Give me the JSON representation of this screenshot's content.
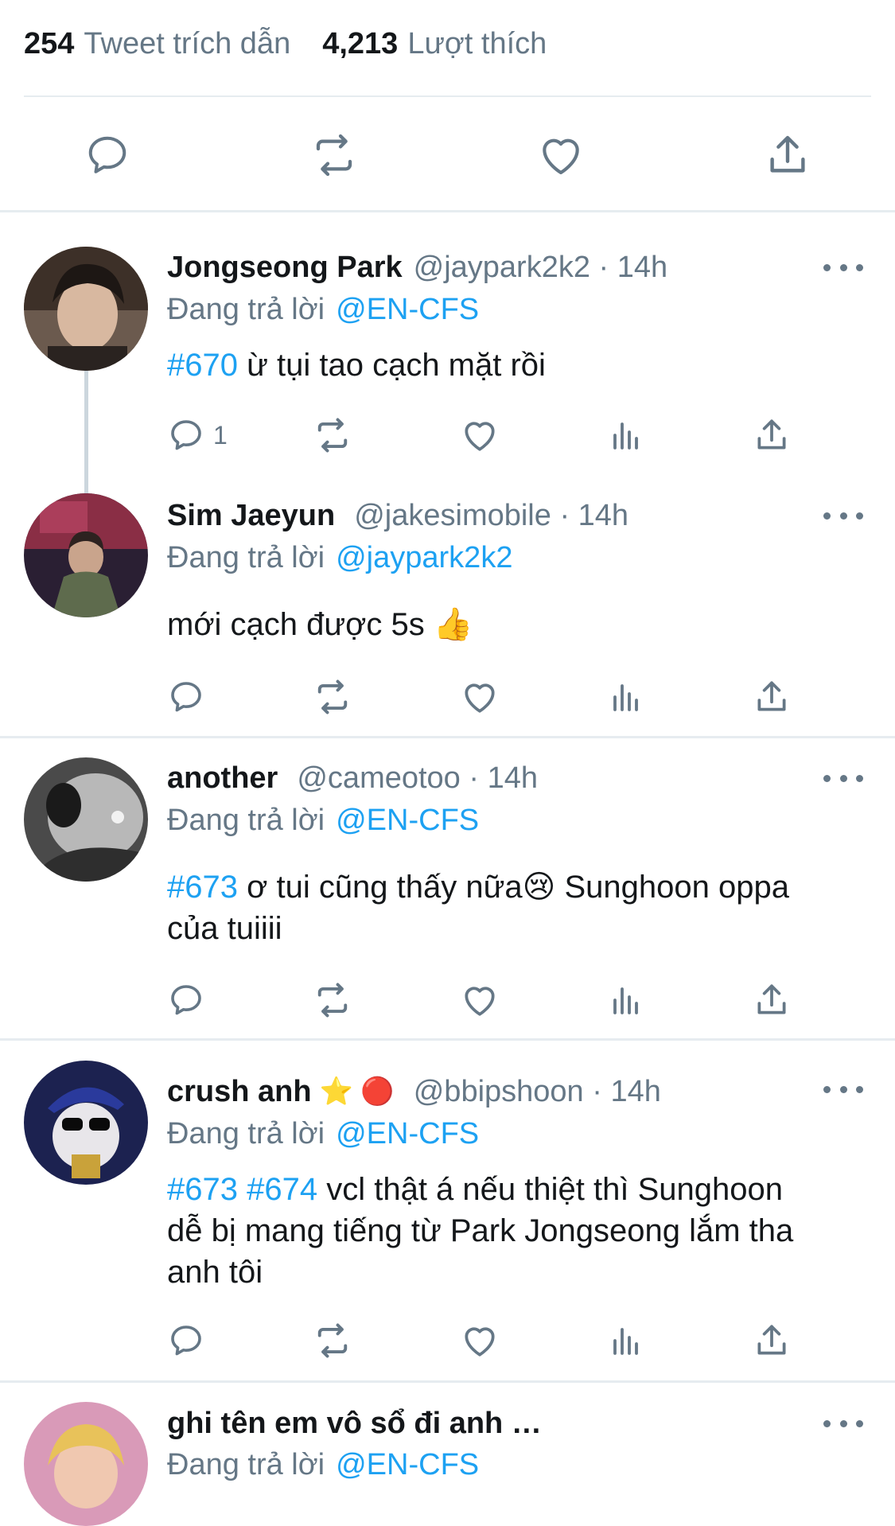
{
  "stats": {
    "quote_count": "254",
    "quote_label": "Tweet trích dẫn",
    "like_count": "4,213",
    "like_label": "Lượt thích"
  },
  "colors": {
    "accent": "#1da1f2",
    "secondary_text": "#657786",
    "divider": "#e6ecf0"
  },
  "reply_prefix": "Đang trả lời",
  "tweets": [
    {
      "name": "Jongseong Park",
      "handle": "@jaypark2k2 · 14h",
      "reply_to": "@EN-CFS",
      "tags": "#670",
      "text": "ừ tụi tao cạch mặt rồi",
      "reply_count": "1"
    },
    {
      "name": "Sim Jaeyun",
      "handle": "@jakesimobile · 14h",
      "reply_to": "@jaypark2k2",
      "text": "mới cạch được 5s 👍"
    },
    {
      "name": "another",
      "handle": "@cameotoo · 14h",
      "reply_to": "@EN-CFS",
      "tags": "#673",
      "text_line1": "ơ tui cũng thấy nữa😢  Sunghoon oppa",
      "text_line2": "của tuiiii"
    },
    {
      "name": "crush anh",
      "name_emoji": "⭐ 🔴",
      "handle": "@bbipshoon · 14h",
      "reply_to": "@EN-CFS",
      "tags": "#673 #674",
      "text_line1": "vcl thật á nếu thiệt thì Sunghoon",
      "text_line2": "dễ bị mang tiếng từ Park Jongseong lắm tha",
      "text_line3": "anh tôi"
    },
    {
      "name": "ghi tên em vô sổ đi anh …",
      "reply_to": "@EN-CFS"
    }
  ]
}
